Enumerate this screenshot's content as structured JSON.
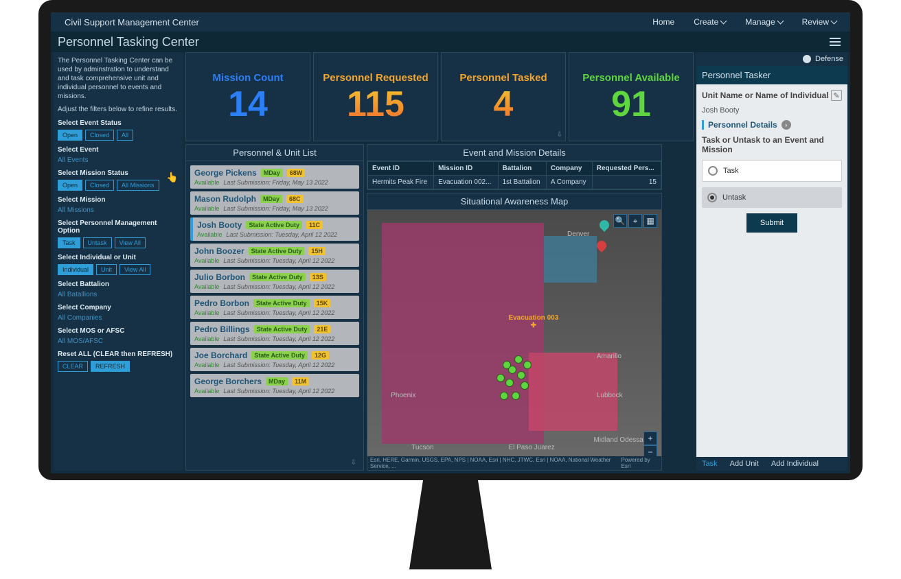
{
  "topbar": {
    "brand": "Civil Support Management Center",
    "nav": [
      "Home",
      "Create",
      "Manage",
      "Review"
    ]
  },
  "page": {
    "title": "Personnel Tasking Center"
  },
  "sidebar": {
    "intro1": "The Personnel Tasking Center can be used by adminstration to understand and task comprehensive unit and individual personnel to events and missions.",
    "intro2": "Adjust the filters below to refine results.",
    "event_status": {
      "label": "Select Event Status",
      "btns": [
        "Open",
        "Closed",
        "All"
      ]
    },
    "event": {
      "label": "Select Event",
      "value": "All Events"
    },
    "mission_status": {
      "label": "Select Mission Status",
      "btns": [
        "Open",
        "Closed",
        "All Missions"
      ]
    },
    "mission": {
      "label": "Select Mission",
      "value": "All Missions"
    },
    "pmo": {
      "label": "Select Personnel Management Option",
      "btns": [
        "Task",
        "Untask",
        "View All"
      ]
    },
    "iu": {
      "label": "Select Individual or Unit",
      "btns": [
        "Individual",
        "Unit",
        "View All"
      ]
    },
    "battalion": {
      "label": "Select Battalion",
      "value": "All Batallions"
    },
    "company": {
      "label": "Select Company",
      "value": "All Companies"
    },
    "mos": {
      "label": "Select MOS or AFSC",
      "value": "All MOS/AFSC"
    },
    "reset": {
      "label": "Reset ALL (CLEAR then REFRESH)",
      "btns": [
        "CLEAR",
        "REFRESH"
      ]
    }
  },
  "kpi": [
    {
      "label": "Mission Count",
      "value": "14"
    },
    {
      "label": "Personnel Requested",
      "value": "115"
    },
    {
      "label": "Personnel Tasked",
      "value": "4"
    },
    {
      "label": "Personnel Available",
      "value": "91"
    }
  ],
  "unit_list": {
    "title": "Personnel & Unit List",
    "items": [
      {
        "name": "George Pickens",
        "p1": "MDay",
        "p2": "68W",
        "avail": "Available",
        "sub": "Last Submission: Friday, May 13 2022"
      },
      {
        "name": "Mason Rudolph",
        "p1": "MDay",
        "p2": "68C",
        "avail": "Available",
        "sub": "Last Submission: Friday, May 13 2022"
      },
      {
        "name": "Josh Booty",
        "p1": "State Active Duty",
        "p2": "11C",
        "avail": "Available",
        "sub": "Last Submission: Tuesday, April 12 2022",
        "sel": true
      },
      {
        "name": "John Boozer",
        "p1": "State Active Duty",
        "p2": "15H",
        "avail": "Available",
        "sub": "Last Submission: Tuesday, April 12 2022"
      },
      {
        "name": "Julio Borbon",
        "p1": "State Active Duty",
        "p2": "13S",
        "avail": "Available",
        "sub": "Last Submission: Tuesday, April 12 2022"
      },
      {
        "name": "Pedro Borbon",
        "p1": "State Active Duty",
        "p2": "15K",
        "avail": "Available",
        "sub": "Last Submission: Tuesday, April 12 2022"
      },
      {
        "name": "Pedro Billings",
        "p1": "State Active Duty",
        "p2": "21E",
        "avail": "Available",
        "sub": "Last Submission: Tuesday, April 12 2022"
      },
      {
        "name": "Joe Borchard",
        "p1": "State Active Duty",
        "p2": "12G",
        "avail": "Available",
        "sub": "Last Submission: Tuesday, April 12 2022"
      },
      {
        "name": "George Borchers",
        "p1": "MDay",
        "p2": "11M",
        "avail": "Available",
        "sub": "Last Submission: Tuesday, April 12 2022"
      }
    ]
  },
  "event_details": {
    "title": "Event and Mission Details",
    "headers": [
      "Event ID",
      "Mission ID",
      "Battalion",
      "Company",
      "Requested Pers..."
    ],
    "row": [
      "Hermits Peak Fire",
      "Evacuation 002...",
      "1st Battalion",
      "A Company",
      "15"
    ]
  },
  "map": {
    "title": "Situational Awareness Map",
    "evac": "Evacuation 003",
    "cities": [
      "Phoenix",
      "Tucson",
      "Denver",
      "Amarillo",
      "Lubbock",
      "Midland Odessa",
      "El Paso Juarez"
    ],
    "attr": "Esri, HERE, Garmin, USGS, EPA, NPS | NOAA, Esri | NHC, JTWC, Esri | NOAA, National Weather Service, ...",
    "poweredby": "Powered by Esri"
  },
  "tasker": {
    "brand": "Defense",
    "title": "Personnel Tasker",
    "unit_label": "Unit Name or Name of Individual",
    "unit_value": "Josh Booty",
    "section": "Personnel Details",
    "task_label": "Task or Untask to an Event and Mission",
    "opt_task": "Task",
    "opt_untask": "Untask",
    "submit": "Submit",
    "tabs": [
      "Task",
      "Add Unit",
      "Add Individual"
    ]
  }
}
